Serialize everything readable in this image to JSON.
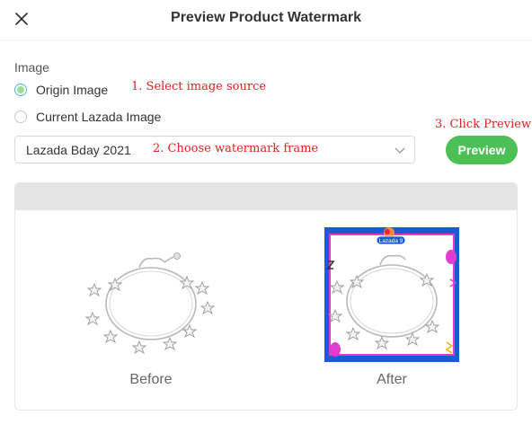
{
  "dialog": {
    "title": "Preview Product Watermark"
  },
  "image_source": {
    "label": "Image",
    "options": [
      {
        "label": "Origin Image",
        "checked": true
      },
      {
        "label": "Current Lazada Image",
        "checked": false
      }
    ]
  },
  "frame_select": {
    "value": "Lazada Bday 2021"
  },
  "preview_button": {
    "label": "Preview",
    "color": "#4cbf56"
  },
  "annotations": {
    "step1": "1. Select image source",
    "step2": "2. Choose watermark frame",
    "step3": "3. Click Preview",
    "color": "#e02020"
  },
  "comparison": {
    "before_label": "Before",
    "after_label": "After",
    "frame_badge": "Lazada 9"
  }
}
